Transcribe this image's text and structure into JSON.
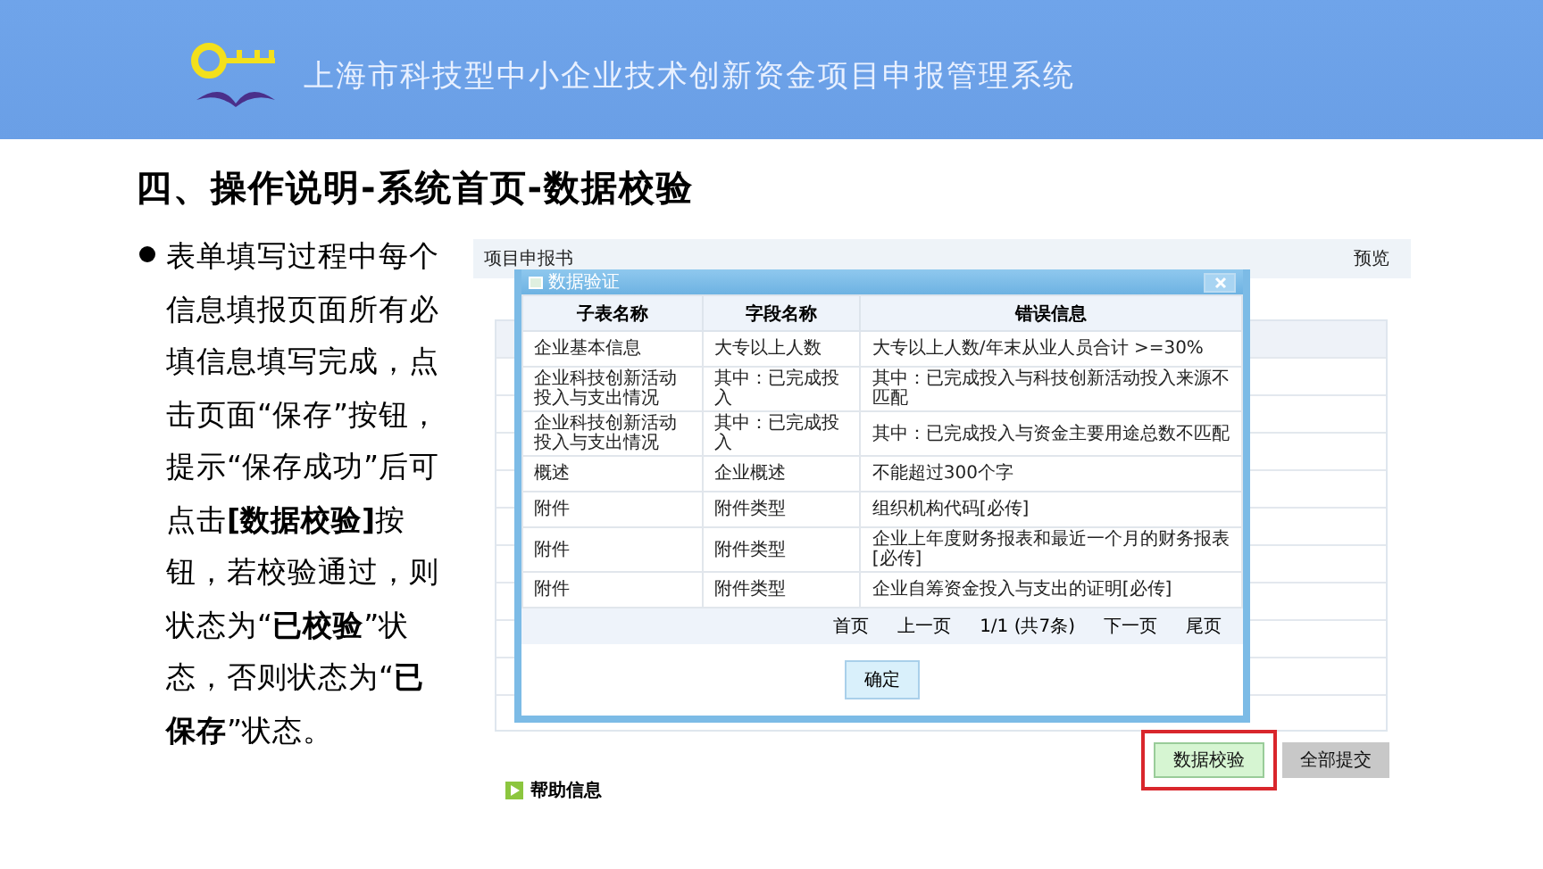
{
  "header": {
    "title": "上海市科技型中小企业技术创新资金项目申报管理系统"
  },
  "heading": "四、操作说明-系统首页-数据校验",
  "bullets": [
    "表单填写过程中每个信息填报页面所有必填信息填写完成，点击页面“保存”按钮，提示“保存成功”后可点击**[数据校验]**按钮，若校验通过，则状态为“**已校验**”状态，否则状态为“**已保存**”状态。"
  ],
  "screenshot": {
    "toolbar_title": "项目申报书",
    "preview_link": "预览",
    "dialog": {
      "title": "数据验证",
      "columns": [
        "子表名称",
        "字段名称",
        "错误信息"
      ],
      "rows": [
        [
          "企业基本信息",
          "大专以上人数",
          "大专以上人数/年末从业人员合计 >=30%"
        ],
        [
          "企业科技创新活动投入与支出情况",
          "其中：已完成投入",
          "其中：已完成投入与科技创新活动投入来源不匹配"
        ],
        [
          "企业科技创新活动投入与支出情况",
          "其中：已完成投入",
          "其中：已完成投入与资金主要用途总数不匹配"
        ],
        [
          "概述",
          "企业概述",
          "不能超过300个字"
        ],
        [
          "附件",
          "附件类型",
          "组织机构代码[必传]"
        ],
        [
          "附件",
          "附件类型",
          "企业上年度财务报表和最近一个月的财务报表[必传]"
        ],
        [
          "附件",
          "附件类型",
          "企业自筹资金投入与支出的证明[必传]"
        ]
      ],
      "pager": [
        "首页",
        "上一页",
        "1/1 (共7条)",
        "下一页",
        "尾页"
      ],
      "confirm_button": "确定"
    },
    "buttons": [
      {
        "label": "数据校验",
        "highlighted": true
      },
      {
        "label": "全部提交",
        "highlighted": false
      }
    ],
    "help_link": "帮助信息"
  }
}
